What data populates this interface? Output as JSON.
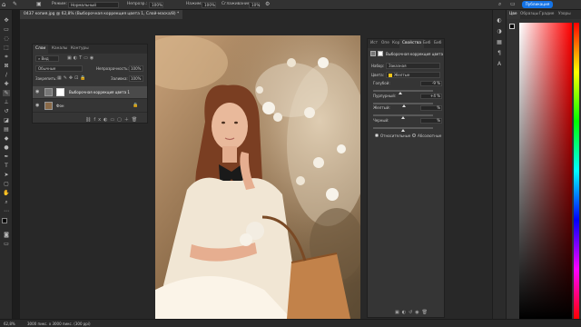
{
  "options_bar": {
    "mode_label": "Режим:",
    "mode_value": "Нормальный",
    "opacity_label": "Непрозр.:",
    "opacity_value": "100%",
    "pressure_label": "Нажим:",
    "pressure_value": "100%",
    "smoothing_label": "Сглаживание:",
    "smoothing_value": "10%",
    "publish_label": "Публикация"
  },
  "document_tab": {
    "title": "0437 копия.jpg @ 62,8% (Выборочная коррекция цвета 1, Слой-маска/8) *"
  },
  "layers_panel": {
    "tabs": [
      "Слои",
      "Каналы",
      "Контуры"
    ],
    "kind_value": "Вид",
    "blend_mode": "Обычные",
    "opacity_label": "Непрозрачность:",
    "opacity_value": "100%",
    "lock_label": "Закрепить:",
    "fill_label": "Заливка:",
    "fill_value": "100%",
    "layers": [
      {
        "name": "Выборочная коррекция цвета 1"
      },
      {
        "name": "Фон"
      }
    ]
  },
  "properties_panel": {
    "tabs": [
      "Ист",
      "Опе",
      "Кор",
      "Свойства",
      "Биб",
      "Биб"
    ],
    "header": "Выборочная коррекция цвета",
    "preset_label": "Набор:",
    "preset_value": "Заказная",
    "colors_label": "Цвета:",
    "colors_value": "Желтые",
    "sliders": [
      {
        "label": "Голубой:",
        "value": "-9",
        "unit": "%",
        "level": 0.455
      },
      {
        "label": "Пурпурный:",
        "value": "+4",
        "unit": "%",
        "level": 0.52
      },
      {
        "label": "Желтый:",
        "value": "",
        "unit": "%",
        "level": 0.5
      },
      {
        "label": "Черный:",
        "value": "",
        "unit": "%",
        "level": 0.5
      }
    ],
    "radio_relative": "Относительные",
    "radio_absolute": "Абсолютные"
  },
  "color_panel": {
    "tabs": [
      "Цве",
      "Образцы",
      "Градие",
      "Узоры"
    ]
  },
  "status_bar": {
    "zoom": "62,8%",
    "dimensions": "3000 пикс. x 3000 пикс. (300 ppi)"
  },
  "colors": {
    "accent": "#1473e6",
    "panel": "#353535",
    "yellow_swatch": "#f0c419"
  }
}
